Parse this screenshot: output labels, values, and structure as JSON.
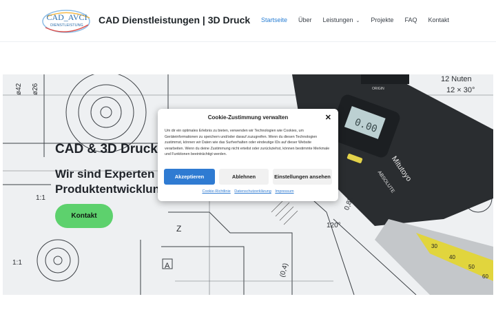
{
  "header": {
    "logo": {
      "line1": "CAD_AVCI",
      "line2": "DIENSTLEISTUNG"
    },
    "site_title": "CAD Dienstleistungen | 3D Druck",
    "nav": [
      {
        "label": "Startseite"
      },
      {
        "label": "Über"
      },
      {
        "label": "Leistungen"
      },
      {
        "label": "Projekte"
      },
      {
        "label": "FAQ"
      },
      {
        "label": "Kontakt"
      }
    ]
  },
  "hero": {
    "title": "CAD & 3D Druck",
    "subtitle_line1": "Wir sind Experten f",
    "subtitle_line2": "Produktentwicklung",
    "button": "Kontakt",
    "drawing_labels": {
      "nuten_1": "12 Nuten",
      "nuten_2": "12 × 30°",
      "scale_1": "1:1",
      "scale_2": "1:1",
      "dim_04": "(0,4)",
      "dim_085": "0,85",
      "angle_120": "120°",
      "letter_z": "Z",
      "letter_a": "A",
      "caliper_brand": "Mitutoyo",
      "caliper_code": "ABSOLUTE",
      "caliper_origin": "ORIGIN",
      "caliper_display": "0.00",
      "scale_30": "30",
      "scale_40": "40",
      "scale_50": "50",
      "scale_60": "60",
      "phi_1": "ø26",
      "phi_2": "ø42"
    },
    "colors": {
      "button": "#5dd16d",
      "text": "#1f2329"
    }
  },
  "cookie": {
    "title": "Cookie-Zustimmung verwalten",
    "text": "Um dir ein optimales Erlebnis zu bieten, verwenden wir Technologien wie Cookies, um Geräteinformationen zu speichern und/oder darauf zuzugreifen. Wenn du diesen Technologien zustimmst, können wir Daten wie das Surfverhalten oder eindeutige IDs auf dieser Website verarbeiten. Wenn du deine Zustimmung nicht erteilst oder zurückziehst, können bestimmte Merkmale und Funktionen beeinträchtigt werden.",
    "buttons": {
      "accept": "Akzeptieren",
      "deny": "Ablehnen",
      "settings": "Einstellungen ansehen"
    },
    "links": [
      "Cookie-Richtlinie",
      "Datenschutzerklärung",
      "Impressum"
    ],
    "colors": {
      "primary": "#2f7bd2"
    }
  }
}
